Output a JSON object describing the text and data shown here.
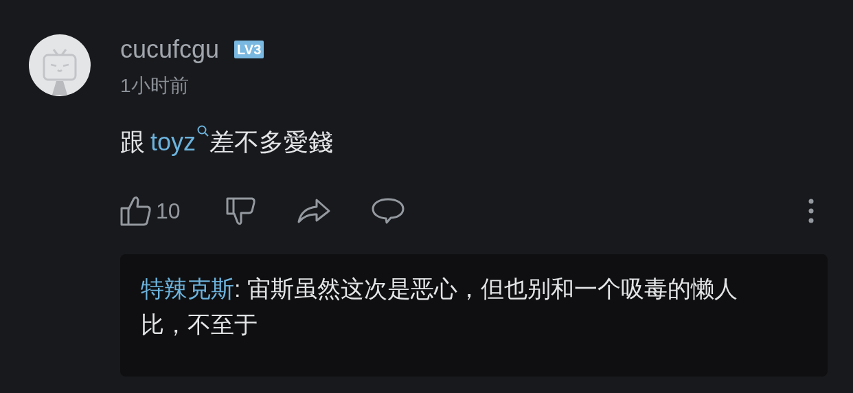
{
  "comment": {
    "username": "cucufcgu",
    "level_badge": "LV3",
    "time": "1小时前",
    "content": {
      "before": "跟",
      "link": "toyz",
      "after": "差不多愛錢"
    },
    "likes": "10",
    "reply": {
      "author": "特辣克斯",
      "text": ": 宙斯虽然这次是恶心，但也别和一个吸毒的懒人比，不至于"
    }
  }
}
